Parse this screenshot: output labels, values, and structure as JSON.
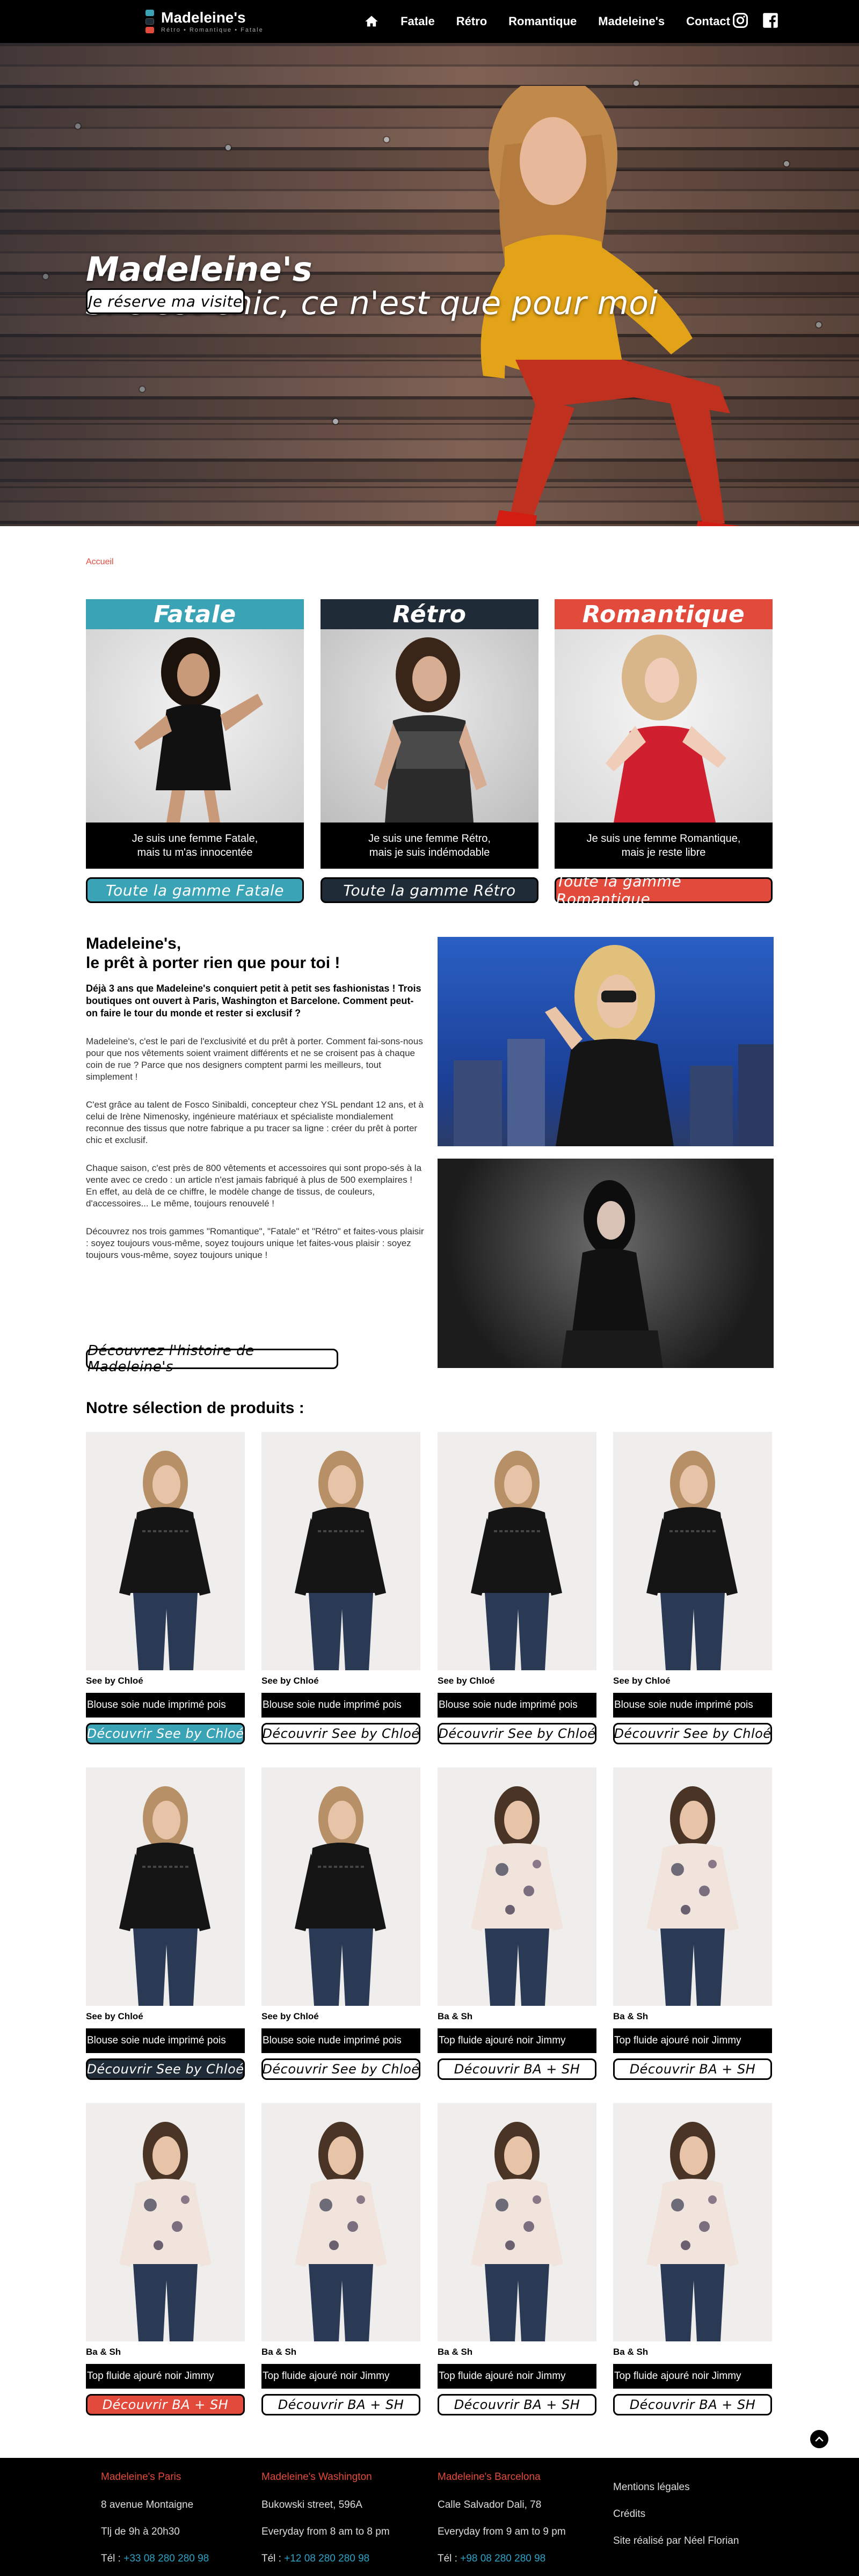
{
  "brand": {
    "name": "Madeleine's",
    "tagline": "Rétro • Romantique • Fatale"
  },
  "nav": {
    "items": [
      {
        "label": "Fatale"
      },
      {
        "label": "Rétro"
      },
      {
        "label": "Romantique"
      },
      {
        "label": "Madeleine's"
      },
      {
        "label": "Contact"
      }
    ],
    "icons": [
      "home-icon",
      "instagram-icon",
      "facebook-icon"
    ]
  },
  "hero": {
    "title": "Madeleine's",
    "subtitle": "Si c'est chic, ce n'est que pour moi",
    "button": "Je réserve ma visite"
  },
  "breadcrumb": "Accueil",
  "gammes": [
    {
      "title": "Fatale",
      "text1": "Je suis une femme Fatale,",
      "text2": "mais tu m'as innocentée",
      "button": "Toute la gamme Fatale",
      "color": "#3ba3b6"
    },
    {
      "title": "Rétro",
      "text1": "Je suis une femme Rétro,",
      "text2": "mais je suis indémodable",
      "button": "Toute la gamme Rétro",
      "color": "#1f2b36"
    },
    {
      "title": "Romantique",
      "text1": "Je suis une femme Romantique,",
      "text2": "mais je reste libre",
      "button": "Toute la gamme Romantique",
      "color": "#e24b3b"
    }
  ],
  "intro": {
    "title_line1": "Madeleine's,",
    "title_line2": "le prêt à porter rien que pour toi !",
    "lead": "Déjà 3 ans que Madeleine's conquiert petit à petit ses fashionistas ! Trois boutiques ont ouvert à Paris, Washington et Barcelone. Comment peut-on faire le tour du monde et rester si exclusif ?",
    "p1": "Madeleine's, c'est le pari de l'exclusivité et du prêt à porter. Comment fai-sons-nous pour que nos vêtements soient vraiment différents et ne se croisent pas à chaque coin de rue ? Parce que nos designers comptent parmi les meilleurs, tout simplement !",
    "p2": "C'est grâce au talent de Fosco Sinibaldi, concepteur chez YSL pendant 12 ans, et à celui de Irène Nimenosky, ingénieure matériaux et spécialiste mondialement reconnue des tissus que notre fabrique a pu tracer sa ligne : créer du prêt à porter chic et exclusif.",
    "p3": "Chaque saison, c'est près de 800 vêtements et accessoires qui sont propo-sés à la vente avec ce credo : un article n'est jamais fabriqué à plus de 500 exemplaires ! En effet, au delà de ce chiffre, le modèle change de tissus, de couleurs, d'accessoires... Le même, toujours renouvelé !",
    "p4": "Découvrez nos trois gammes \"Romantique\", \"Fatale\" et \"Rétro\" et faites-vous plaisir : soyez toujours vous-même, soyez toujours unique !et faites-vous plaisir : soyez toujours vous-même, soyez toujours unique !",
    "button": "Découvrez l'histoire de Madeleine's"
  },
  "selection_title": "Notre sélection de produits :",
  "products": [
    {
      "brand": "See by Chloé",
      "desc": "Blouse soie nude imprimé pois",
      "button": "Découvrir See by Chloé",
      "btn_color": "#3ba3b6",
      "btn_text": "#ffffff",
      "kind": "black"
    },
    {
      "brand": "See by Chloé",
      "desc": "Blouse soie nude imprimé pois",
      "button": "Découvrir See by Chloé",
      "btn_color": "#ffffff",
      "btn_text": "#000000",
      "kind": "black"
    },
    {
      "brand": "See by Chloé",
      "desc": "Blouse soie nude imprimé pois",
      "button": "Découvrir See by Chloé",
      "btn_color": "#ffffff",
      "btn_text": "#000000",
      "kind": "black"
    },
    {
      "brand": "See by Chloé",
      "desc": "Blouse soie nude imprimé pois",
      "button": "Découvrir See by Chloé",
      "btn_color": "#ffffff",
      "btn_text": "#000000",
      "kind": "black"
    },
    {
      "brand": "See by Chloé",
      "desc": "Blouse soie nude imprimé pois",
      "button": "Découvrir See by Chloé",
      "btn_color": "#1f2b36",
      "btn_text": "#ffffff",
      "kind": "black"
    },
    {
      "brand": "See by Chloé",
      "desc": "Blouse soie nude imprimé pois",
      "button": "Découvrir See by Chloé",
      "btn_color": "#ffffff",
      "btn_text": "#000000",
      "kind": "black"
    },
    {
      "brand": "Ba & Sh",
      "desc": "Top fluide ajouré noir Jimmy",
      "button": "Découvrir BA + SH",
      "btn_color": "#ffffff",
      "btn_text": "#000000",
      "kind": "floral"
    },
    {
      "brand": "Ba & Sh",
      "desc": "Top fluide ajouré noir Jimmy",
      "button": "Découvrir BA + SH",
      "btn_color": "#ffffff",
      "btn_text": "#000000",
      "kind": "floral"
    },
    {
      "brand": "Ba & Sh",
      "desc": "Top fluide ajouré noir Jimmy",
      "button": "Découvrir BA + SH",
      "btn_color": "#e24b3b",
      "btn_text": "#ffffff",
      "kind": "floral"
    },
    {
      "brand": "Ba & Sh",
      "desc": "Top fluide ajouré noir Jimmy",
      "button": "Découvrir BA + SH",
      "btn_color": "#ffffff",
      "btn_text": "#000000",
      "kind": "floral"
    },
    {
      "brand": "Ba & Sh",
      "desc": "Top fluide ajouré noir Jimmy",
      "button": "Découvrir BA + SH",
      "btn_color": "#ffffff",
      "btn_text": "#000000",
      "kind": "floral"
    },
    {
      "brand": "Ba & Sh",
      "desc": "Top fluide ajouré noir Jimmy",
      "button": "Découvrir BA + SH",
      "btn_color": "#ffffff",
      "btn_text": "#000000",
      "kind": "floral"
    }
  ],
  "footer": {
    "shops": [
      {
        "name": "Madeleine's Paris",
        "address": "8 avenue Montaigne",
        "hours": "Tlj de 9h à 20h30",
        "tel_label": "Tél :",
        "tel": "+33 08 280 280 98"
      },
      {
        "name": "Madeleine's Washington",
        "address": "Bukowski street, 596A",
        "hours": "Everyday from 8 am to 8 pm",
        "tel_label": "Tél :",
        "tel": "+12 08 280 280 98"
      },
      {
        "name": "Madeleine's Barcelona",
        "address": "Calle Salvador Dali, 78",
        "hours": "Everyday from 9 am to 9 pm",
        "tel_label": "Tél :",
        "tel": "+98 08 280 280 98"
      }
    ],
    "links": [
      "Mentions légales",
      "Crédits",
      "Site réalisé par Néel Florian"
    ]
  },
  "colors": {
    "accent": "#e24b3b",
    "fatale": "#3ba3b6",
    "retro": "#1f2b36",
    "link": "#2aa3c7"
  }
}
